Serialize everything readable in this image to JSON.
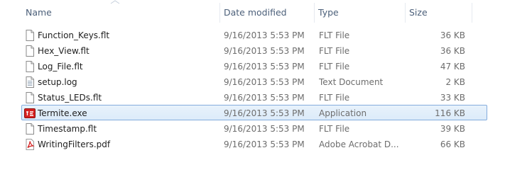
{
  "columns": {
    "name": "Name",
    "date": "Date modified",
    "type": "Type",
    "size": "Size"
  },
  "files": [
    {
      "name": "Function_Keys.flt",
      "date": "9/16/2013 5:53 PM",
      "type": "FLT File",
      "size": "36 KB",
      "icon": "blank-file-icon",
      "selected": false
    },
    {
      "name": "Hex_View.flt",
      "date": "9/16/2013 5:53 PM",
      "type": "FLT File",
      "size": "36 KB",
      "icon": "blank-file-icon",
      "selected": false
    },
    {
      "name": "Log_File.flt",
      "date": "9/16/2013 5:53 PM",
      "type": "FLT File",
      "size": "47 KB",
      "icon": "blank-file-icon",
      "selected": false
    },
    {
      "name": "setup.log",
      "date": "9/16/2013 5:53 PM",
      "type": "Text Document",
      "size": "2 KB",
      "icon": "text-document-icon",
      "selected": false
    },
    {
      "name": "Status_LEDs.flt",
      "date": "9/16/2013 5:53 PM",
      "type": "FLT File",
      "size": "33 KB",
      "icon": "blank-file-icon",
      "selected": false
    },
    {
      "name": "Termite.exe",
      "date": "9/16/2013 5:53 PM",
      "type": "Application",
      "size": "116 KB",
      "icon": "termite-app-icon",
      "selected": true
    },
    {
      "name": "Timestamp.flt",
      "date": "9/16/2013 5:53 PM",
      "type": "FLT File",
      "size": "39 KB",
      "icon": "blank-file-icon",
      "selected": false
    },
    {
      "name": "WritingFilters.pdf",
      "date": "9/16/2013 5:53 PM",
      "type": "Adobe Acrobat D...",
      "size": "66 KB",
      "icon": "pdf-file-icon",
      "selected": false
    }
  ],
  "colors": {
    "selection_border": "#84acdd",
    "selection_fill": "#dcebfa",
    "header_text": "#4c607a",
    "detail_text": "#6d6d6d"
  }
}
